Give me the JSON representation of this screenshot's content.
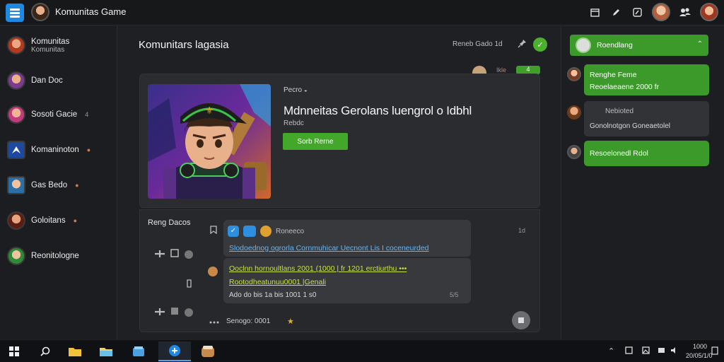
{
  "window": {
    "title": "Komunitas Game"
  },
  "toolbar_icons": [
    "calendar-icon",
    "pen-icon",
    "edit-icon",
    "user-avatar",
    "users-icon",
    "profile-avatar"
  ],
  "sidebar": {
    "items": [
      {
        "label": "Komunitas",
        "sub": "Komunitas",
        "badge": ""
      },
      {
        "label": "Dan Doc",
        "sub": "",
        "badge": ""
      },
      {
        "label": "Sosoti Gacie",
        "sub": "",
        "badge": "4"
      },
      {
        "label": "Komaninoton",
        "sub": "",
        "badge": "●"
      },
      {
        "label": "Gas Bedo",
        "sub": "",
        "badge": "●"
      },
      {
        "label": "Goloitans",
        "sub": "",
        "badge": "●"
      },
      {
        "label": "Reonitologne",
        "sub": "",
        "badge": ""
      }
    ]
  },
  "main": {
    "title": "Komunitars lagasia",
    "meta": "Reneb Gado 1d",
    "mini_text": "Ikle",
    "mini_badge": "4"
  },
  "featured": {
    "label": "Pecro",
    "title": "Mdnneitas Gerolans luengrol o Idbhl",
    "subtitle": "Rebdc",
    "play_label": "Sorb Rerne"
  },
  "chat": {
    "label": "Reng Dacos",
    "messages": [
      {
        "author": "Roneeco",
        "text": "Slodoednog ogrorla Cornmuhicar Uecnont Lis I coceneurded",
        "meta": "1d"
      },
      {
        "line1": "Ooclnn hornoultlans 2001 (1000 | fr 1201 erctiurthu •••",
        "line2": "Rootodheatunuu0001 |Genali",
        "line3": "Ado do bis 1a bis 1001 1 s0",
        "meta": "5/5"
      }
    ],
    "composer": "Senogo: 0001"
  },
  "right_panel": {
    "header": "Roendlang",
    "messages": [
      {
        "line1": "Renghe Feme",
        "line2": "Reoelaeaene 2000 fr"
      },
      {
        "line1": "Nebioted",
        "line2": "Gonolnotgon Goneaetolel"
      },
      {
        "line1": "Resoelonedl Rdol",
        "line2": ""
      }
    ]
  },
  "taskbar": {
    "apps": [
      "windows-start-icon",
      "search-icon",
      "file-explorer-icon",
      "folder-icon",
      "store-icon",
      "game-app-icon",
      "coffee-app-icon"
    ],
    "clock_time": "1000",
    "clock_date": "20/05/1/0"
  },
  "colors": {
    "accent_green": "#3c9a2a",
    "accent_blue": "#1e88e5",
    "background": "#1f2023"
  }
}
